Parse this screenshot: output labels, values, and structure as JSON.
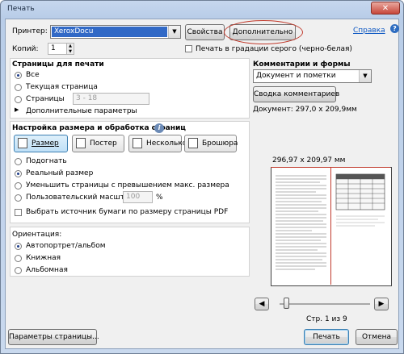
{
  "window": {
    "title": "Печать",
    "close_icon": "close-icon"
  },
  "printer": {
    "label": "Принтер:",
    "value": "XeroxDocu",
    "properties_button": "Свойства",
    "advanced_button": "Дополнительно",
    "help_link": "Справка"
  },
  "copies": {
    "label": "Копий:",
    "value": "1"
  },
  "grayscale_checkbox": {
    "label": "Печать в градации серого (черно-белая)",
    "checked": false
  },
  "pages": {
    "heading": "Страницы для печати",
    "options": [
      "Все",
      "Текущая страница",
      "Страницы"
    ],
    "selected": "Все",
    "range_value": "3 - 18",
    "more_options": "Дополнительные параметры"
  },
  "sizing": {
    "heading": "Настройка размера и обработка страниц",
    "info_icon": "info-icon",
    "tabs": [
      "Размер",
      "Постер",
      "Несколько",
      "Брошюра"
    ],
    "active_tab": "Размер",
    "options": [
      "Подогнать",
      "Реальный размер",
      "Уменьшить страницы с превышением макс. размера",
      "Пользовательский масштаб:"
    ],
    "selected": "Реальный размер",
    "scale_value": "100",
    "scale_unit": "%",
    "paper_source_checkbox": "Выбрать источник бумаги по размеру страницы PDF"
  },
  "orientation": {
    "heading": "Ориентация:",
    "options": [
      "Автопортрет/альбом",
      "Книжная",
      "Альбомная"
    ],
    "selected": "Автопортрет/альбом"
  },
  "comments": {
    "heading": "Комментарии и формы",
    "value": "Документ и пометки",
    "summary_button": "Сводка комментариев"
  },
  "document_size": "Документ: 297,0 x 209,9мм",
  "preview": {
    "sheet_size": "296,97 x 209,97 мм",
    "page_indicator": "Стр. 1 из 9",
    "slider_position": 0.05
  },
  "buttons": {
    "page_setup": "Параметры страницы...",
    "print": "Печать",
    "cancel": "Отмена"
  }
}
